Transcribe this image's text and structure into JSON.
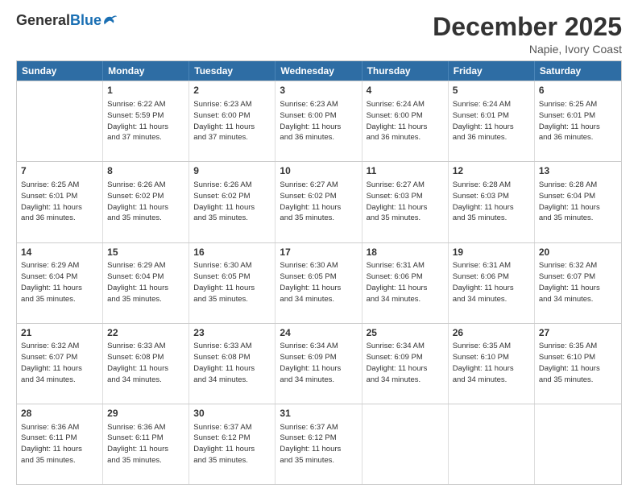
{
  "header": {
    "logo_general": "General",
    "logo_blue": "Blue",
    "title": "December 2025",
    "location": "Napie, Ivory Coast"
  },
  "weekdays": [
    "Sunday",
    "Monday",
    "Tuesday",
    "Wednesday",
    "Thursday",
    "Friday",
    "Saturday"
  ],
  "weeks": [
    [
      {
        "day": "",
        "lines": []
      },
      {
        "day": "1",
        "lines": [
          "Sunrise: 6:22 AM",
          "Sunset: 5:59 PM",
          "Daylight: 11 hours",
          "and 37 minutes."
        ]
      },
      {
        "day": "2",
        "lines": [
          "Sunrise: 6:23 AM",
          "Sunset: 6:00 PM",
          "Daylight: 11 hours",
          "and 37 minutes."
        ]
      },
      {
        "day": "3",
        "lines": [
          "Sunrise: 6:23 AM",
          "Sunset: 6:00 PM",
          "Daylight: 11 hours",
          "and 36 minutes."
        ]
      },
      {
        "day": "4",
        "lines": [
          "Sunrise: 6:24 AM",
          "Sunset: 6:00 PM",
          "Daylight: 11 hours",
          "and 36 minutes."
        ]
      },
      {
        "day": "5",
        "lines": [
          "Sunrise: 6:24 AM",
          "Sunset: 6:01 PM",
          "Daylight: 11 hours",
          "and 36 minutes."
        ]
      },
      {
        "day": "6",
        "lines": [
          "Sunrise: 6:25 AM",
          "Sunset: 6:01 PM",
          "Daylight: 11 hours",
          "and 36 minutes."
        ]
      }
    ],
    [
      {
        "day": "7",
        "lines": [
          "Sunrise: 6:25 AM",
          "Sunset: 6:01 PM",
          "Daylight: 11 hours",
          "and 36 minutes."
        ]
      },
      {
        "day": "8",
        "lines": [
          "Sunrise: 6:26 AM",
          "Sunset: 6:02 PM",
          "Daylight: 11 hours",
          "and 35 minutes."
        ]
      },
      {
        "day": "9",
        "lines": [
          "Sunrise: 6:26 AM",
          "Sunset: 6:02 PM",
          "Daylight: 11 hours",
          "and 35 minutes."
        ]
      },
      {
        "day": "10",
        "lines": [
          "Sunrise: 6:27 AM",
          "Sunset: 6:02 PM",
          "Daylight: 11 hours",
          "and 35 minutes."
        ]
      },
      {
        "day": "11",
        "lines": [
          "Sunrise: 6:27 AM",
          "Sunset: 6:03 PM",
          "Daylight: 11 hours",
          "and 35 minutes."
        ]
      },
      {
        "day": "12",
        "lines": [
          "Sunrise: 6:28 AM",
          "Sunset: 6:03 PM",
          "Daylight: 11 hours",
          "and 35 minutes."
        ]
      },
      {
        "day": "13",
        "lines": [
          "Sunrise: 6:28 AM",
          "Sunset: 6:04 PM",
          "Daylight: 11 hours",
          "and 35 minutes."
        ]
      }
    ],
    [
      {
        "day": "14",
        "lines": [
          "Sunrise: 6:29 AM",
          "Sunset: 6:04 PM",
          "Daylight: 11 hours",
          "and 35 minutes."
        ]
      },
      {
        "day": "15",
        "lines": [
          "Sunrise: 6:29 AM",
          "Sunset: 6:04 PM",
          "Daylight: 11 hours",
          "and 35 minutes."
        ]
      },
      {
        "day": "16",
        "lines": [
          "Sunrise: 6:30 AM",
          "Sunset: 6:05 PM",
          "Daylight: 11 hours",
          "and 35 minutes."
        ]
      },
      {
        "day": "17",
        "lines": [
          "Sunrise: 6:30 AM",
          "Sunset: 6:05 PM",
          "Daylight: 11 hours",
          "and 34 minutes."
        ]
      },
      {
        "day": "18",
        "lines": [
          "Sunrise: 6:31 AM",
          "Sunset: 6:06 PM",
          "Daylight: 11 hours",
          "and 34 minutes."
        ]
      },
      {
        "day": "19",
        "lines": [
          "Sunrise: 6:31 AM",
          "Sunset: 6:06 PM",
          "Daylight: 11 hours",
          "and 34 minutes."
        ]
      },
      {
        "day": "20",
        "lines": [
          "Sunrise: 6:32 AM",
          "Sunset: 6:07 PM",
          "Daylight: 11 hours",
          "and 34 minutes."
        ]
      }
    ],
    [
      {
        "day": "21",
        "lines": [
          "Sunrise: 6:32 AM",
          "Sunset: 6:07 PM",
          "Daylight: 11 hours",
          "and 34 minutes."
        ]
      },
      {
        "day": "22",
        "lines": [
          "Sunrise: 6:33 AM",
          "Sunset: 6:08 PM",
          "Daylight: 11 hours",
          "and 34 minutes."
        ]
      },
      {
        "day": "23",
        "lines": [
          "Sunrise: 6:33 AM",
          "Sunset: 6:08 PM",
          "Daylight: 11 hours",
          "and 34 minutes."
        ]
      },
      {
        "day": "24",
        "lines": [
          "Sunrise: 6:34 AM",
          "Sunset: 6:09 PM",
          "Daylight: 11 hours",
          "and 34 minutes."
        ]
      },
      {
        "day": "25",
        "lines": [
          "Sunrise: 6:34 AM",
          "Sunset: 6:09 PM",
          "Daylight: 11 hours",
          "and 34 minutes."
        ]
      },
      {
        "day": "26",
        "lines": [
          "Sunrise: 6:35 AM",
          "Sunset: 6:10 PM",
          "Daylight: 11 hours",
          "and 34 minutes."
        ]
      },
      {
        "day": "27",
        "lines": [
          "Sunrise: 6:35 AM",
          "Sunset: 6:10 PM",
          "Daylight: 11 hours",
          "and 35 minutes."
        ]
      }
    ],
    [
      {
        "day": "28",
        "lines": [
          "Sunrise: 6:36 AM",
          "Sunset: 6:11 PM",
          "Daylight: 11 hours",
          "and 35 minutes."
        ]
      },
      {
        "day": "29",
        "lines": [
          "Sunrise: 6:36 AM",
          "Sunset: 6:11 PM",
          "Daylight: 11 hours",
          "and 35 minutes."
        ]
      },
      {
        "day": "30",
        "lines": [
          "Sunrise: 6:37 AM",
          "Sunset: 6:12 PM",
          "Daylight: 11 hours",
          "and 35 minutes."
        ]
      },
      {
        "day": "31",
        "lines": [
          "Sunrise: 6:37 AM",
          "Sunset: 6:12 PM",
          "Daylight: 11 hours",
          "and 35 minutes."
        ]
      },
      {
        "day": "",
        "lines": []
      },
      {
        "day": "",
        "lines": []
      },
      {
        "day": "",
        "lines": []
      }
    ]
  ]
}
